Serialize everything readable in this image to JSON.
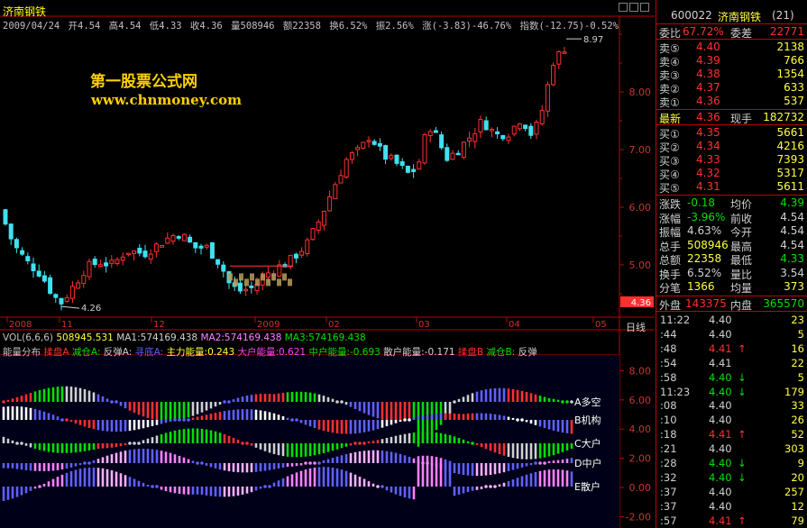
{
  "stock": {
    "code": "600022",
    "name": "济南钢铁",
    "count": "(21)"
  },
  "chart_title": "济南钢铁",
  "info": {
    "date": "2009/04/24",
    "open": "开4.54",
    "high": "高4.54",
    "low": "低4.33",
    "close": "收4.36",
    "vol": "量508946",
    "amount": "额22358",
    "turnover": "换6.52%",
    "amplitude": "振2.56%",
    "change": "涨(-3.83)-46.76%",
    "index": "指数(-12.75)-0.52%"
  },
  "watermark": {
    "line1": "第一股票公式网",
    "line2": "www.chnmoney.com"
  },
  "price_axis": {
    "labels": [
      "8.00",
      "7.00",
      "6.00",
      "5.00"
    ],
    "current": "4.36"
  },
  "annotations": {
    "high": "8.97",
    "low": "4.26"
  },
  "date_axis": [
    "2008",
    "11",
    "12",
    "2009",
    "02",
    "03",
    "04",
    "05"
  ],
  "period_btn": "日线",
  "vol_line": {
    "label": "VOL(6,6,6)",
    "value": "508945.531",
    "ma1": "MA1:574169.438",
    "ma2": "MA2:574169.438",
    "ma3": "MA3:574169.438"
  },
  "indicator_line": {
    "name": "能量分布",
    "items": [
      "揉盘A",
      "减仓A:",
      "反弹A:",
      "寻底A:",
      "主力能量:0.243",
      "大户能量:0.621",
      "中户能量:-0.693",
      "散户能量:-0.171",
      "揉盘B",
      "减仓B:",
      "反弹"
    ]
  },
  "ind_axis": [
    "8.00",
    "6.00",
    "4.00",
    "2.00",
    "0.00",
    "-2.00"
  ],
  "ind_labels": [
    "A多空",
    "B机构",
    "C大户",
    "D中户",
    "E散户"
  ],
  "orderbook": {
    "ratio_label": "委比",
    "ratio": "67.72%",
    "diff_label": "委差",
    "diff": "22771",
    "asks": [
      {
        "label": "卖⑤",
        "price": "4.40",
        "vol": "2138"
      },
      {
        "label": "卖④",
        "price": "4.39",
        "vol": "766"
      },
      {
        "label": "卖③",
        "price": "4.38",
        "vol": "1354"
      },
      {
        "label": "卖②",
        "price": "4.37",
        "vol": "633"
      },
      {
        "label": "卖①",
        "price": "4.36",
        "vol": "537"
      }
    ],
    "last_label": "最新",
    "last": "4.36",
    "cur_vol_label": "现手",
    "cur_vol": "182732",
    "bids": [
      {
        "label": "买①",
        "price": "4.35",
        "vol": "5661"
      },
      {
        "label": "买②",
        "price": "4.34",
        "vol": "4216"
      },
      {
        "label": "买③",
        "price": "4.33",
        "vol": "7393"
      },
      {
        "label": "买④",
        "price": "4.32",
        "vol": "5317"
      },
      {
        "label": "买⑤",
        "price": "4.31",
        "vol": "5611"
      }
    ]
  },
  "stats": [
    {
      "l1": "涨跌",
      "v1": "-0.18",
      "l2": "均价",
      "v2": "4.39"
    },
    {
      "l1": "涨幅",
      "v1": "-3.96%",
      "l2": "前收",
      "v2": "4.54"
    },
    {
      "l1": "振幅",
      "v1": "4.63%",
      "l2": "今开",
      "v2": "4.54"
    },
    {
      "l1": "总手",
      "v1": "508946",
      "l2": "最高",
      "v2": "4.54"
    },
    {
      "l1": "总额",
      "v1": "22358",
      "l2": "最低",
      "v2": "4.33"
    },
    {
      "l1": "换手",
      "v1": "6.52%",
      "l2": "量比",
      "v2": "3.54"
    },
    {
      "l1": "分笔",
      "v1": "1366",
      "l2": "均量",
      "v2": "373"
    }
  ],
  "outer_inner": {
    "outer_label": "外盘",
    "outer": "143375",
    "inner_label": "内盘",
    "inner": "365570"
  },
  "ticks": [
    {
      "time": "11:22",
      "price": "4.40",
      "dir": "",
      "vol": "23"
    },
    {
      "time": ":44",
      "price": "4.40",
      "dir": "",
      "vol": "5"
    },
    {
      "time": ":48",
      "price": "4.41",
      "dir": "↑",
      "vol": "16"
    },
    {
      "time": ":54",
      "price": "4.41",
      "dir": "",
      "vol": "22"
    },
    {
      "time": ":58",
      "price": "4.40",
      "dir": "↓",
      "vol": "5"
    },
    {
      "time": "11:23",
      "price": "4.40",
      "dir": "↓",
      "vol": "179"
    },
    {
      "time": ":08",
      "price": "4.40",
      "dir": "",
      "vol": "33"
    },
    {
      "time": ":10",
      "price": "4.40",
      "dir": "",
      "vol": "26"
    },
    {
      "time": ":18",
      "price": "4.41",
      "dir": "↑",
      "vol": "52"
    },
    {
      "time": ":21",
      "price": "4.40",
      "dir": "",
      "vol": "303"
    },
    {
      "time": ":28",
      "price": "4.40",
      "dir": "↓",
      "vol": "9"
    },
    {
      "time": ":32",
      "price": "4.40",
      "dir": "↓",
      "vol": "20"
    },
    {
      "time": ":37",
      "price": "4.40",
      "dir": "",
      "vol": "257"
    },
    {
      "time": ":37",
      "price": "4.40",
      "dir": "",
      "vol": "12"
    },
    {
      "time": ":57",
      "price": "4.41",
      "dir": "↑",
      "vol": "79"
    }
  ],
  "colors": {
    "up": "#ff3030",
    "down": "#40e0f0",
    "border": "#c00000"
  }
}
